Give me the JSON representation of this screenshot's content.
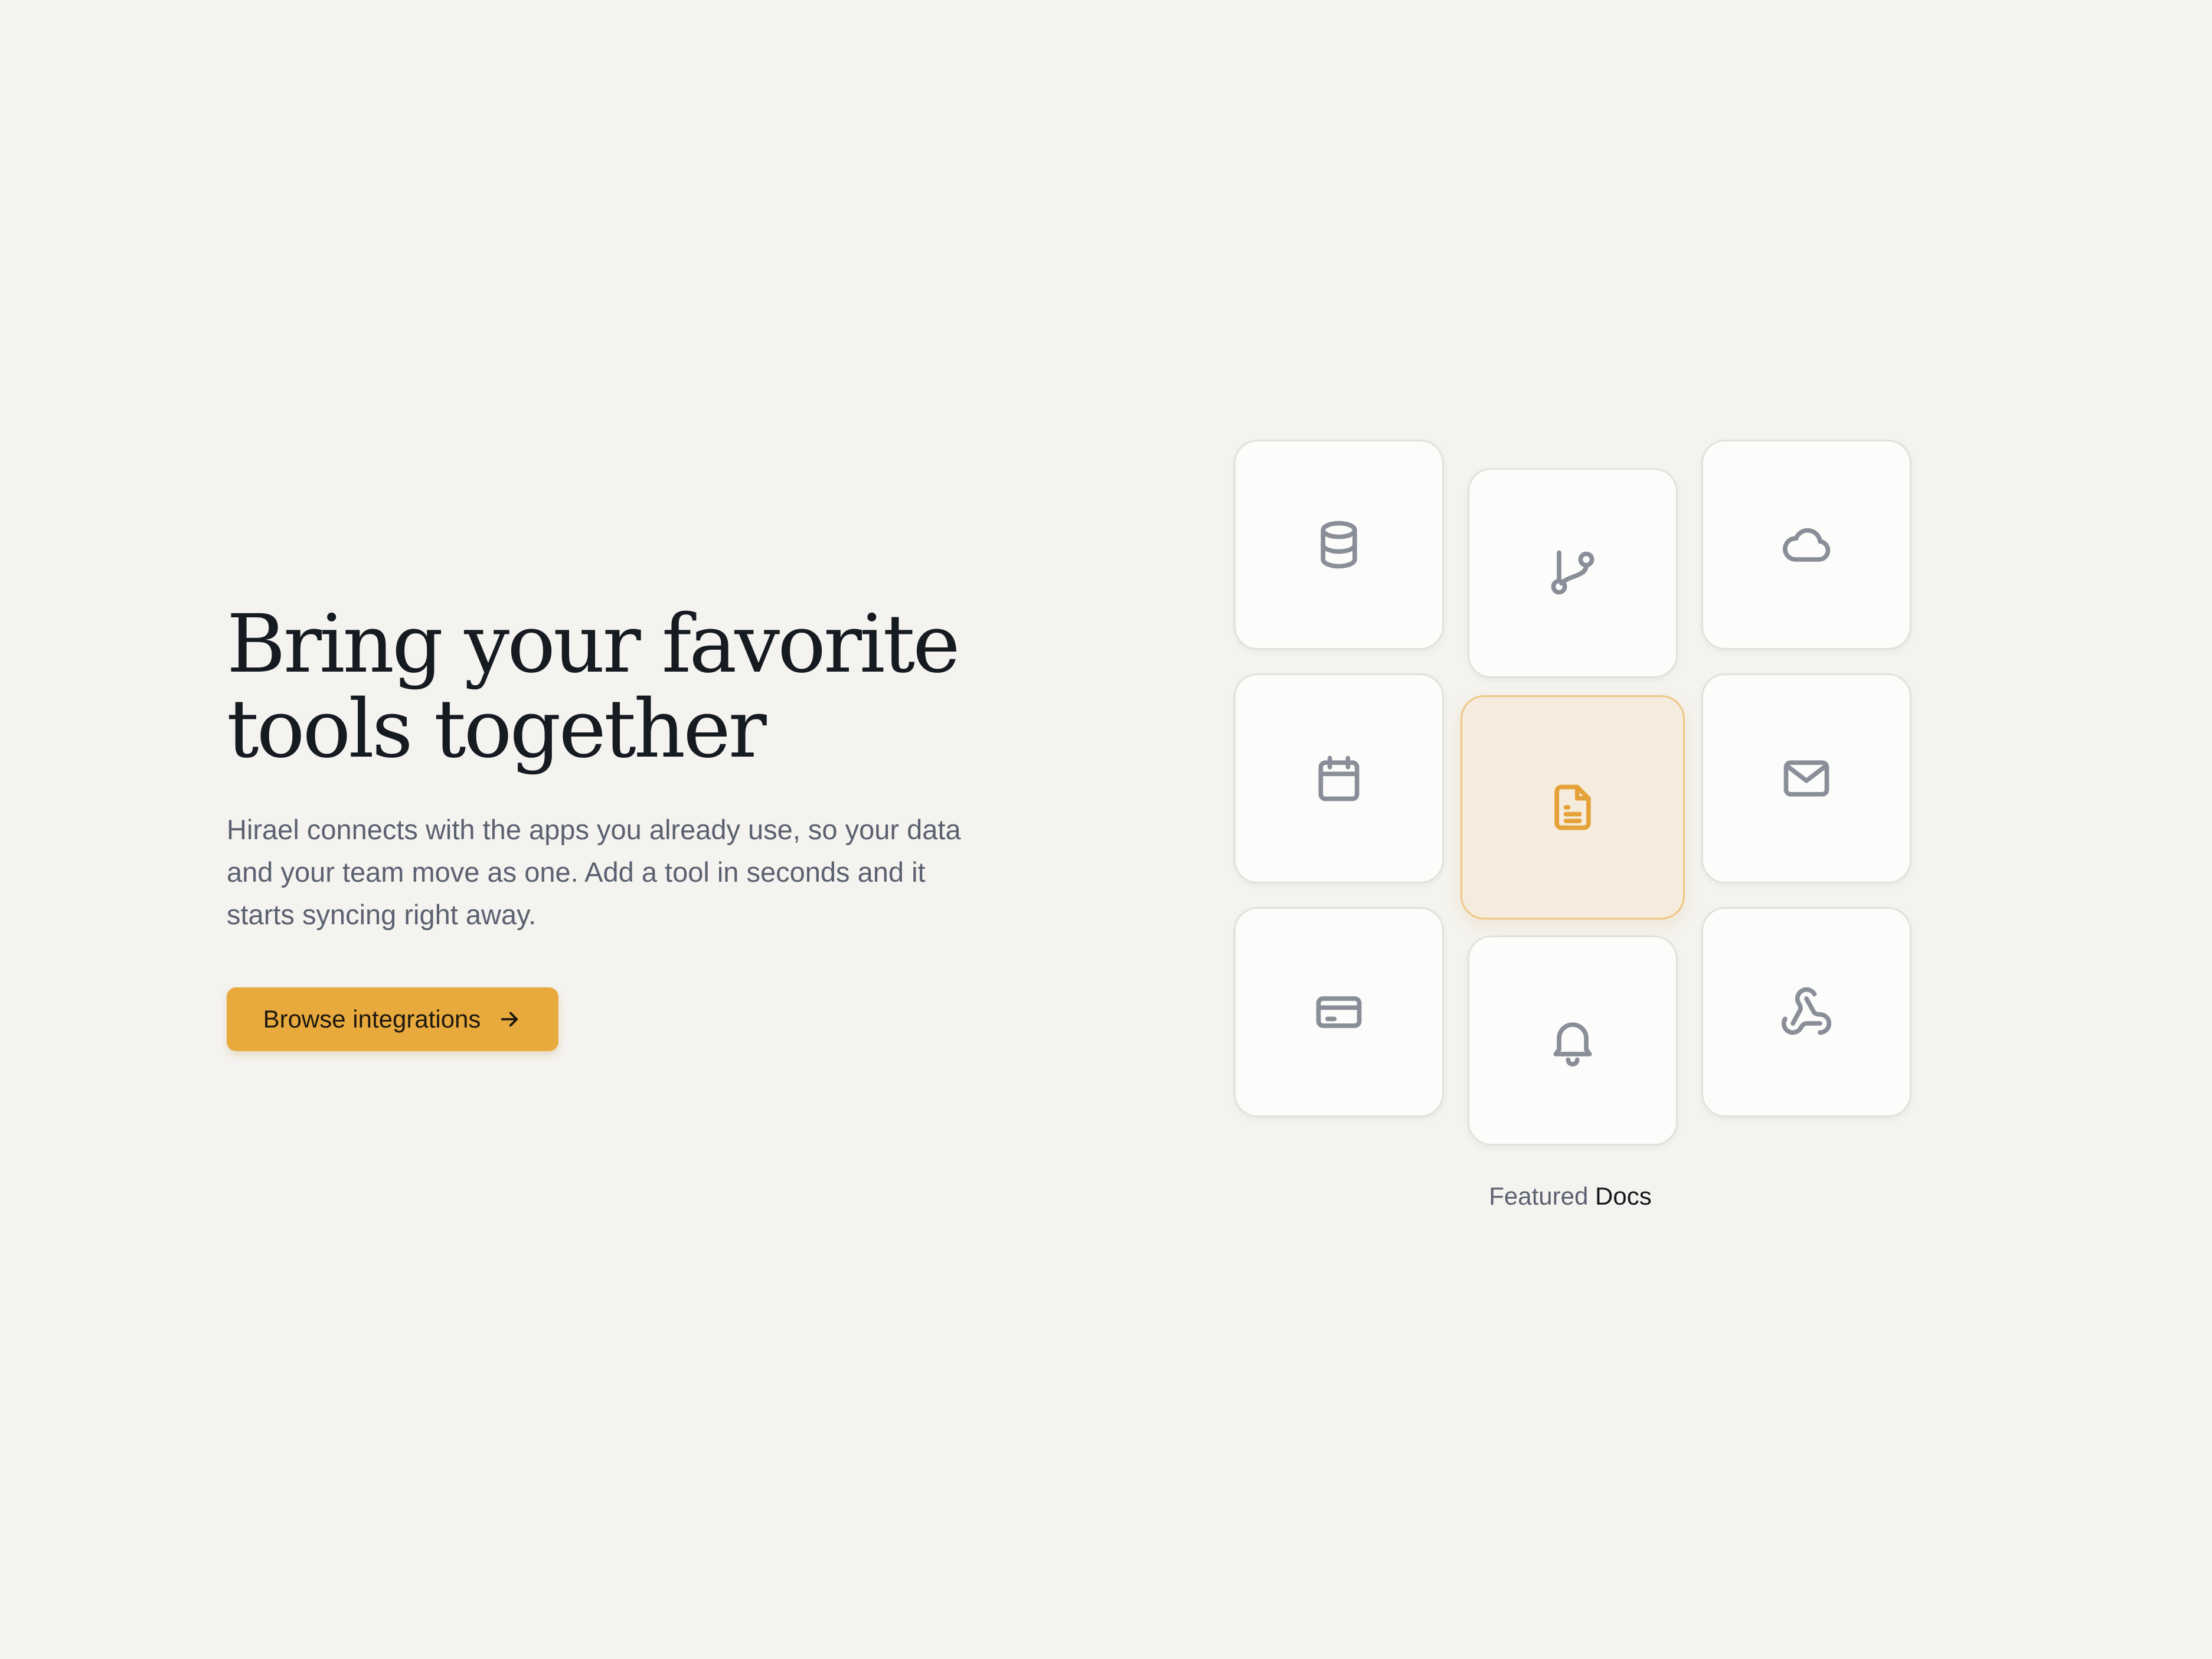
{
  "hero": {
    "headline_line1": "Bring your favorite",
    "headline_line2": "tools together",
    "subtext_line1": "Hirael connects with the apps you already use, so your data",
    "subtext_line2": "and your team move as one. Add a tool in seconds and it",
    "subtext_line3": "starts syncing right away.",
    "cta_label": "Browse integrations",
    "cta_icon": "arrow-right-icon"
  },
  "grid": {
    "tiles": [
      {
        "name": "database-icon"
      },
      {
        "name": "git-branch-icon"
      },
      {
        "name": "cloud-icon"
      },
      {
        "name": "calendar-icon"
      },
      {
        "name": "document-icon",
        "featured": true
      },
      {
        "name": "mail-icon"
      },
      {
        "name": "credit-card-icon"
      },
      {
        "name": "bell-icon"
      },
      {
        "name": "webhook-icon"
      }
    ]
  },
  "featured": {
    "prefix": "Featured",
    "name": "Docs"
  },
  "colors": {
    "background": "#f4f3ef",
    "accent": "#e8aa3d",
    "featured_tile_bg": "#f5ecdd",
    "icon_gray": "#8a8e98",
    "headline": "#161a21",
    "body_text": "#5b6170"
  }
}
